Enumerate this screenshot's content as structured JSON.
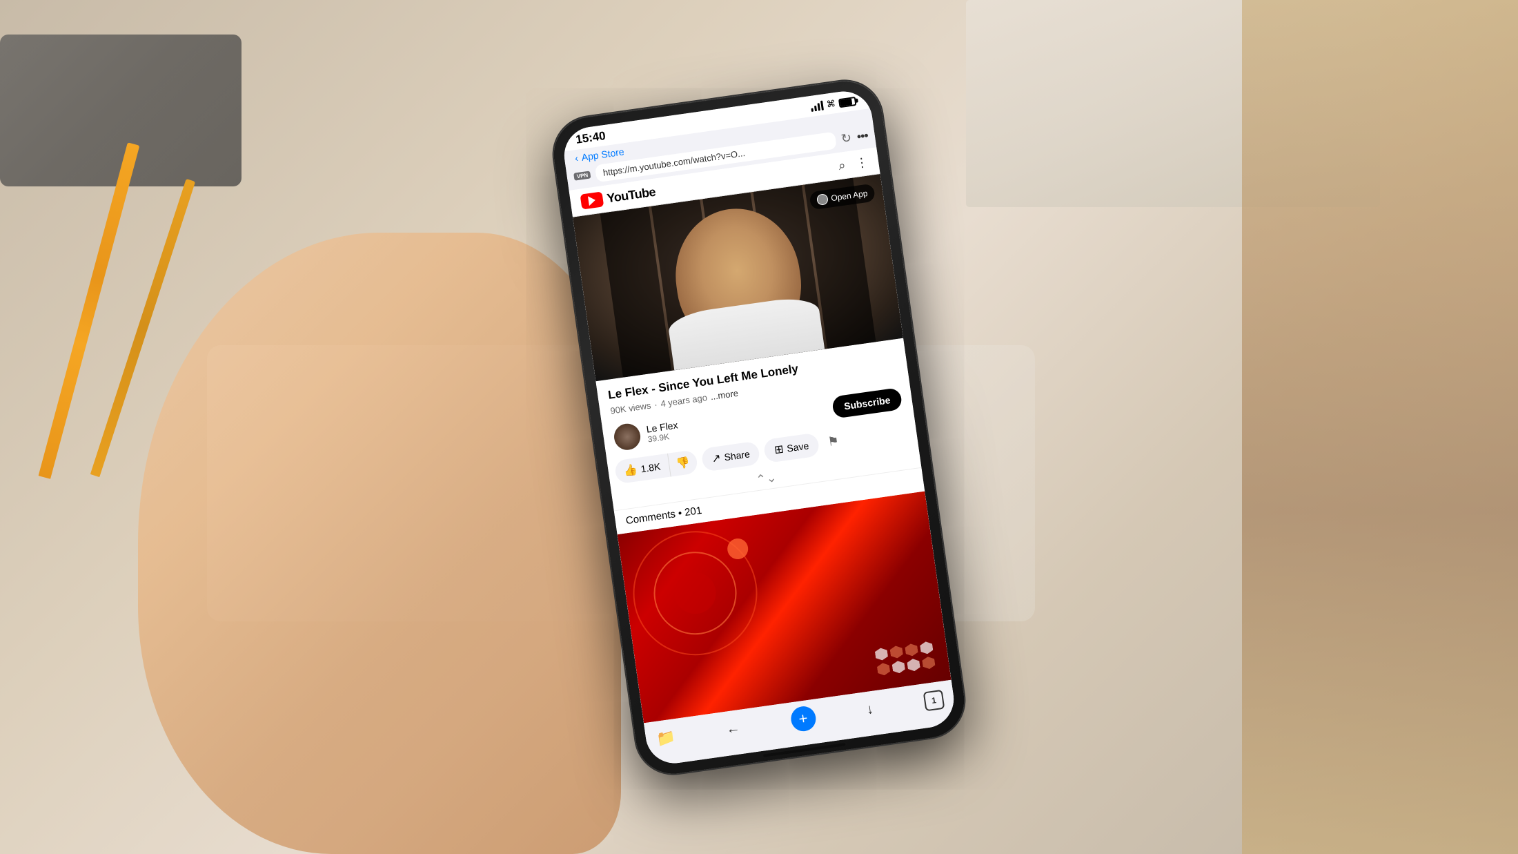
{
  "background": {
    "color": "#d4c5b0"
  },
  "phone": {
    "status_bar": {
      "time": "15:40",
      "battery": "80%"
    },
    "app_store_link": "App Store",
    "url": "https://m.youtube.com/watch?v=O...",
    "vpn_label": "VPN",
    "reload_icon": "↻",
    "more_icon": "...",
    "open_app_label": "Open App",
    "youtube": {
      "wordmark": "YouTube",
      "header_search_icon": "🔍",
      "header_dots_icon": "⋮",
      "video": {
        "title": "Le Flex - Since You Left Me Lonely",
        "views": "90K views",
        "upload_time": "4 years ago",
        "more_label": "...more",
        "channel_name": "Le Flex",
        "channel_subs": "39.9K",
        "subscribe_label": "Subscribe",
        "likes": "1.8K",
        "share_label": "Share",
        "save_label": "Save",
        "comments_label": "Comments",
        "comments_count": "201"
      }
    },
    "browser_bottom": {
      "back_icon": "←",
      "download_icon": "↓",
      "tabs_count": "1",
      "add_icon": "+"
    }
  }
}
